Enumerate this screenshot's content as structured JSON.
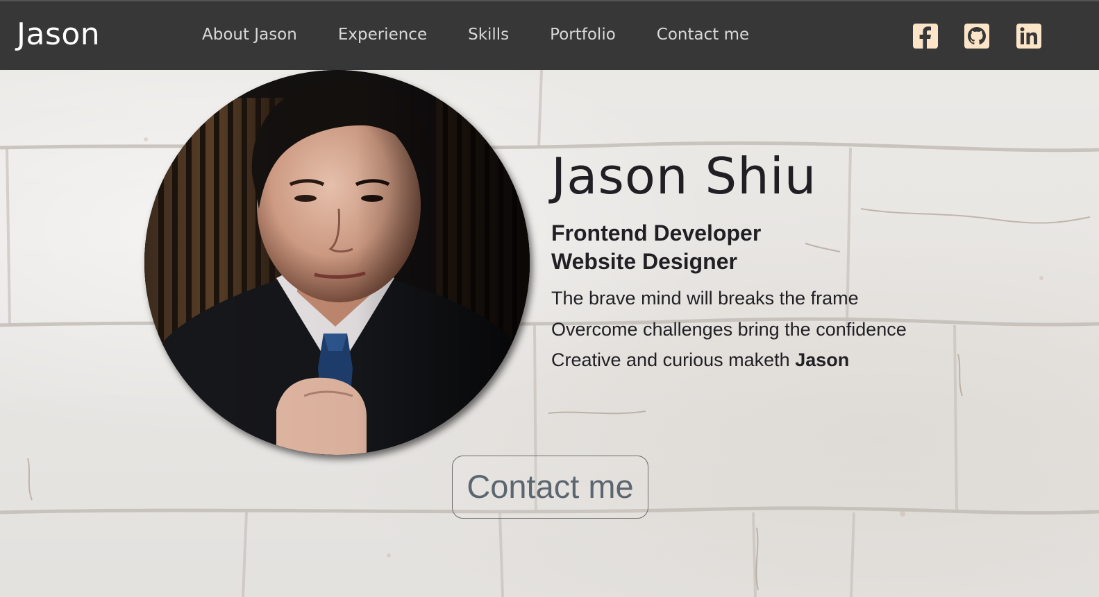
{
  "navbar": {
    "brand": "Jason",
    "links": [
      {
        "label": "About Jason"
      },
      {
        "label": "Experience"
      },
      {
        "label": "Skills"
      },
      {
        "label": "Portfolio"
      },
      {
        "label": "Contact me"
      }
    ],
    "social": [
      {
        "icon": "facebook-icon"
      },
      {
        "icon": "github-icon"
      },
      {
        "icon": "linkedin-icon"
      }
    ]
  },
  "hero": {
    "name": "Jason Shiu",
    "roles": [
      "Frontend Developer",
      "Website Designer"
    ],
    "taglines": [
      "The brave mind will breaks the frame",
      "Overcome challenges bring the confidence"
    ],
    "tagline_last_prefix": "Creative and curious maketh",
    "tagline_last_bold": "Jason",
    "cta_label": "Contact me"
  },
  "colors": {
    "navbar_bg": "#373737",
    "social_icon_bg": "#fbe4c8",
    "text_dark": "#1f1f24",
    "button_text": "#5c6670"
  }
}
